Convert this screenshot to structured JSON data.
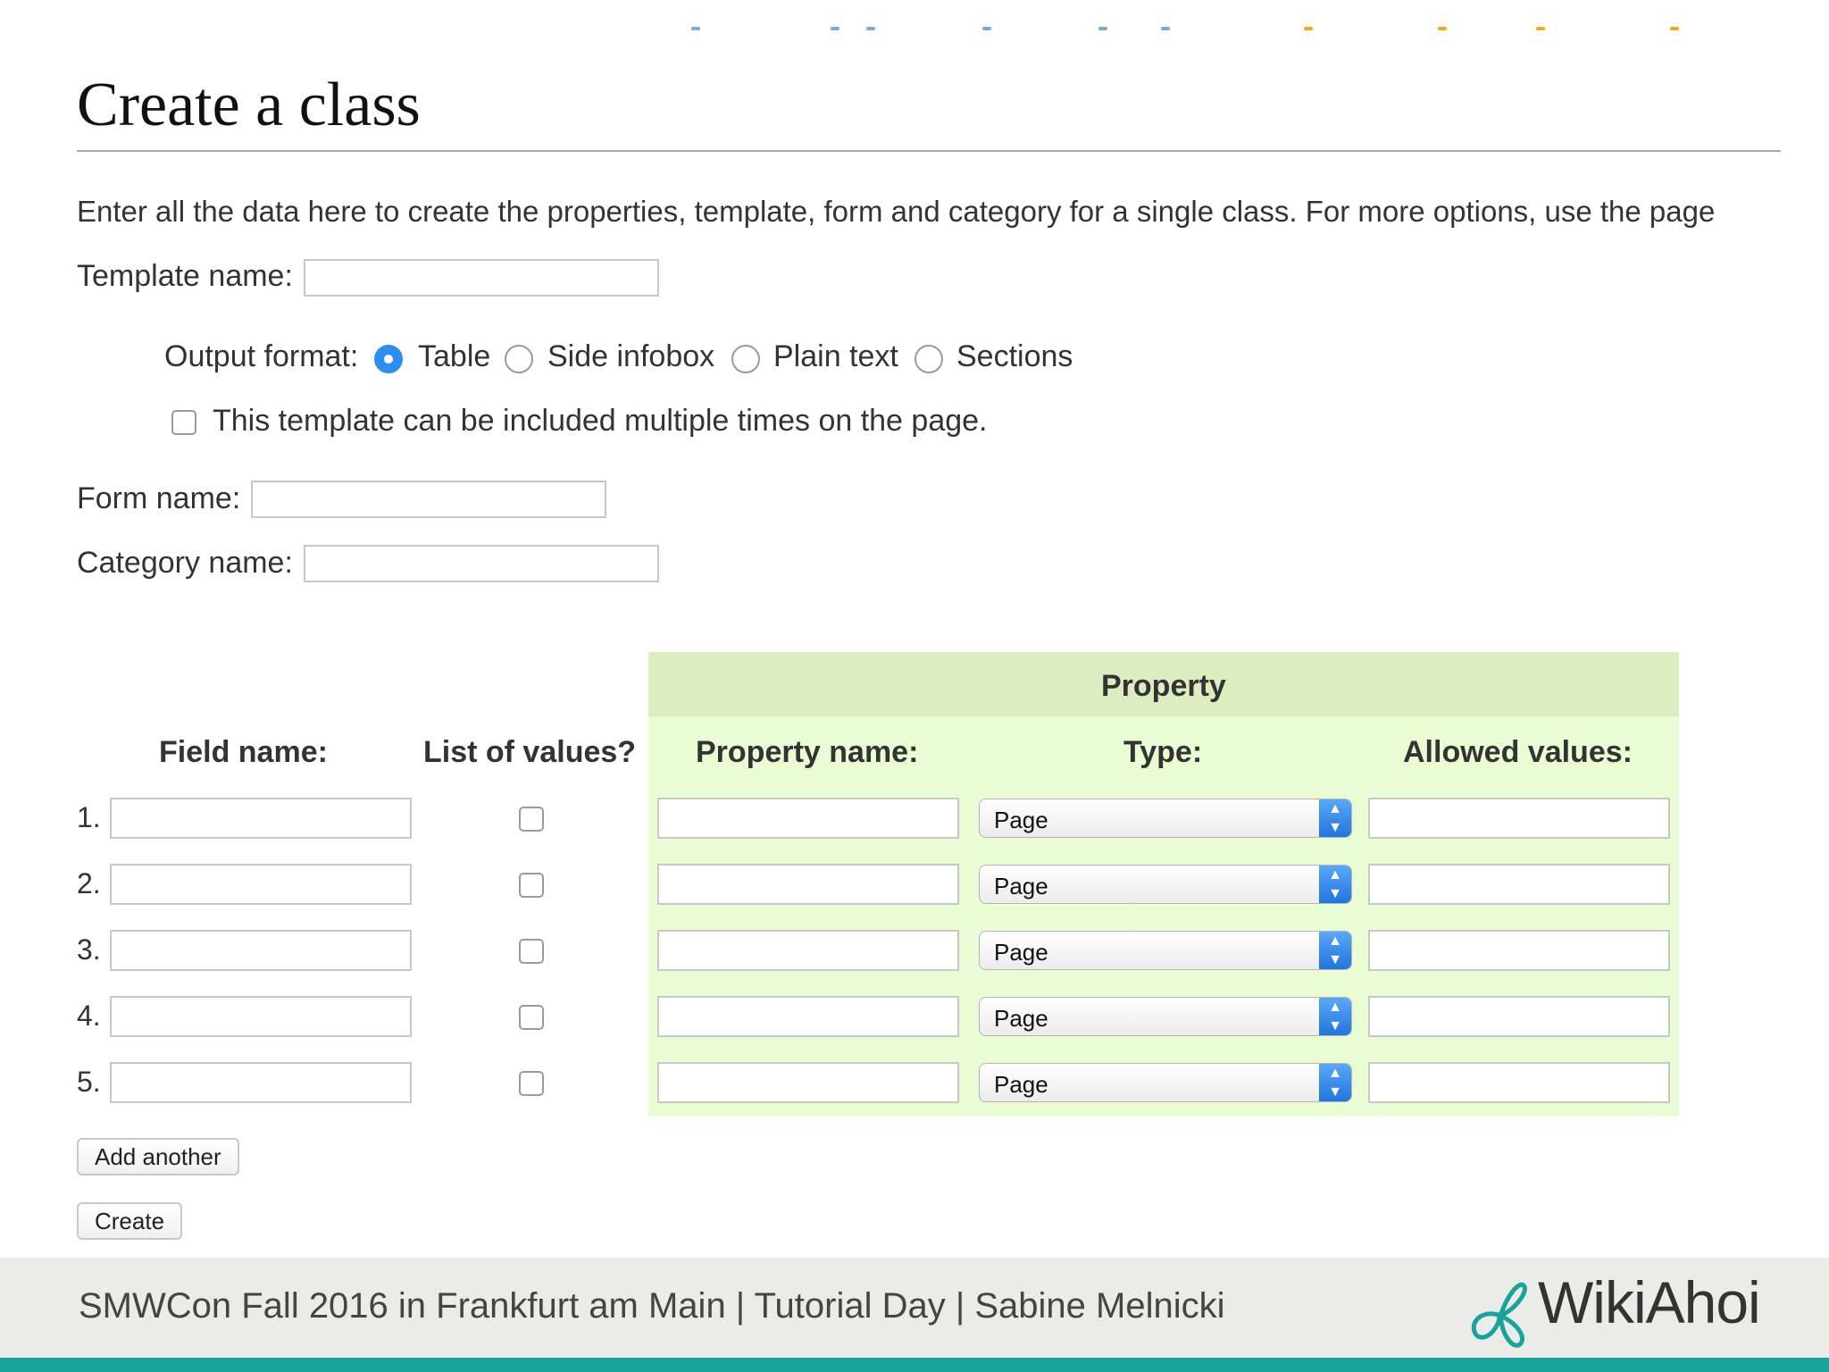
{
  "page": {
    "title": "Create a class",
    "intro": "Enter all the data here to create the properties, template, form and category for a single class. For more options, use the page"
  },
  "template": {
    "label": "Template name:",
    "value": "",
    "output_format_label": "Output format:",
    "formats": [
      {
        "label": "Table",
        "selected": true
      },
      {
        "label": "Side infobox",
        "selected": false
      },
      {
        "label": "Plain text",
        "selected": false
      },
      {
        "label": "Sections",
        "selected": false
      }
    ],
    "multiple_label": "This template can be included multiple times on the page.",
    "multiple_checked": false
  },
  "form": {
    "label": "Form name:",
    "value": ""
  },
  "category": {
    "label": "Category name:",
    "value": ""
  },
  "table": {
    "group_header": "Property",
    "headers": {
      "field_name": "Field name:",
      "list_of_values": "List of values?",
      "property_name": "Property name:",
      "type": "Type:",
      "allowed_values": "Allowed values:"
    },
    "rows": [
      {
        "number": "1.",
        "field": "",
        "is_list": false,
        "property": "",
        "type": "Page",
        "allowed": ""
      },
      {
        "number": "2.",
        "field": "",
        "is_list": false,
        "property": "",
        "type": "Page",
        "allowed": ""
      },
      {
        "number": "3.",
        "field": "",
        "is_list": false,
        "property": "",
        "type": "Page",
        "allowed": ""
      },
      {
        "number": "4.",
        "field": "",
        "is_list": false,
        "property": "",
        "type": "Page",
        "allowed": ""
      },
      {
        "number": "5.",
        "field": "",
        "is_list": false,
        "property": "",
        "type": "Page",
        "allowed": ""
      }
    ]
  },
  "buttons": {
    "add_another": "Add another",
    "create": "Create"
  },
  "footer": {
    "text": "SMWCon Fall 2016 in Frankfurt am Main | Tutorial Day | Sabine Melnicki",
    "logo_text": "WikiAhoi"
  },
  "colors": {
    "property_header_bg": "#dcedc0",
    "property_body_bg": "#eafcd3",
    "radio_accent": "#2f8cf0",
    "footer_bar": "#1aa39a"
  },
  "icons": {
    "select_arrow": "chevron-up-down-icon",
    "logo": "wikiahoi-logo-icon"
  }
}
